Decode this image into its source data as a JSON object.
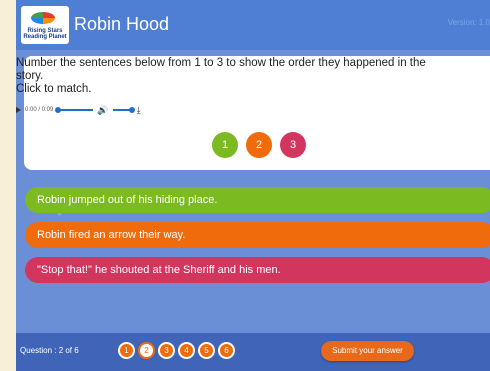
{
  "header": {
    "title": "Robin Hood",
    "version": "Version: 1.0",
    "logo_text": "Rising Stars Reading Planet"
  },
  "activity": {
    "instruction_lines": [
      "Number the sentences below from 1 to 3 to show the order they happened in the",
      "story.",
      "Click to match."
    ],
    "audio_time": "0:00 / 0:09",
    "numbers": [
      "1",
      "2",
      "3"
    ],
    "sentences": [
      "Robin jumped out of his hiding place.",
      "Robin fired an arrow their way.",
      "\"Stop that!\" he shouted at the Sheriff and his men."
    ]
  },
  "footer": {
    "question_label": "Question : 2 of 6",
    "question_numbers": [
      "1",
      "2",
      "3",
      "4",
      "5",
      "6"
    ],
    "submit_label": "Submit your answer"
  },
  "colors": {
    "green": "#7cba21",
    "orange": "#f06b0c",
    "pink": "#d2365f",
    "blue": "#4e7fd4"
  }
}
